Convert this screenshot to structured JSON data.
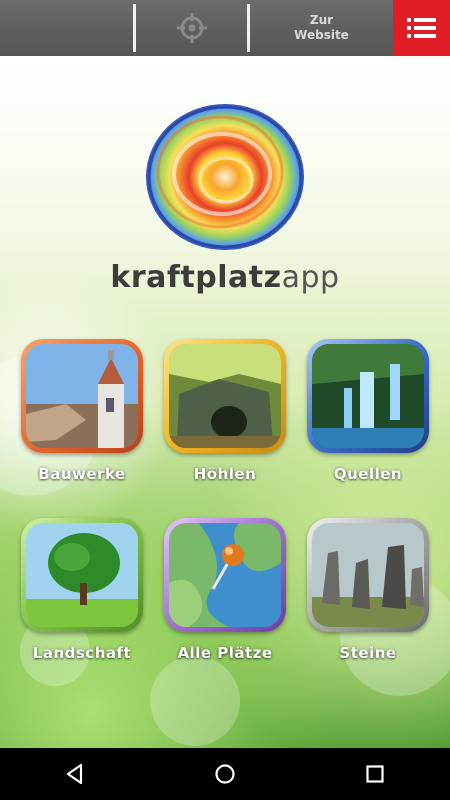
{
  "toolbar": {
    "website_line1": "Zur",
    "website_line2": "Website",
    "locate_icon": "crosshair-icon",
    "menu_icon": "list-menu-icon",
    "menu_color": "#e01c24"
  },
  "logo": {
    "brand_bold": "kraftplatz",
    "brand_light": "app"
  },
  "tiles": [
    {
      "label": "Bauwerke",
      "frame": "#e8692d",
      "icon": "church-icon"
    },
    {
      "label": "Höhlen",
      "frame": "#f2b320",
      "icon": "cave-icon"
    },
    {
      "label": "Quellen",
      "frame": "#3b6fc9",
      "icon": "waterfall-icon"
    },
    {
      "label": "Landschaft",
      "frame": "#7fc04b",
      "icon": "tree-icon"
    },
    {
      "label": "Alle Plätze",
      "frame": "#a16fd1",
      "icon": "map-pin-icon"
    },
    {
      "label": "Steine",
      "frame": "#a8a8a8",
      "icon": "standing-stones-icon"
    }
  ],
  "navbar": {
    "back_icon": "back-triangle-icon",
    "home_icon": "home-circle-icon",
    "recents_icon": "recents-square-icon"
  }
}
